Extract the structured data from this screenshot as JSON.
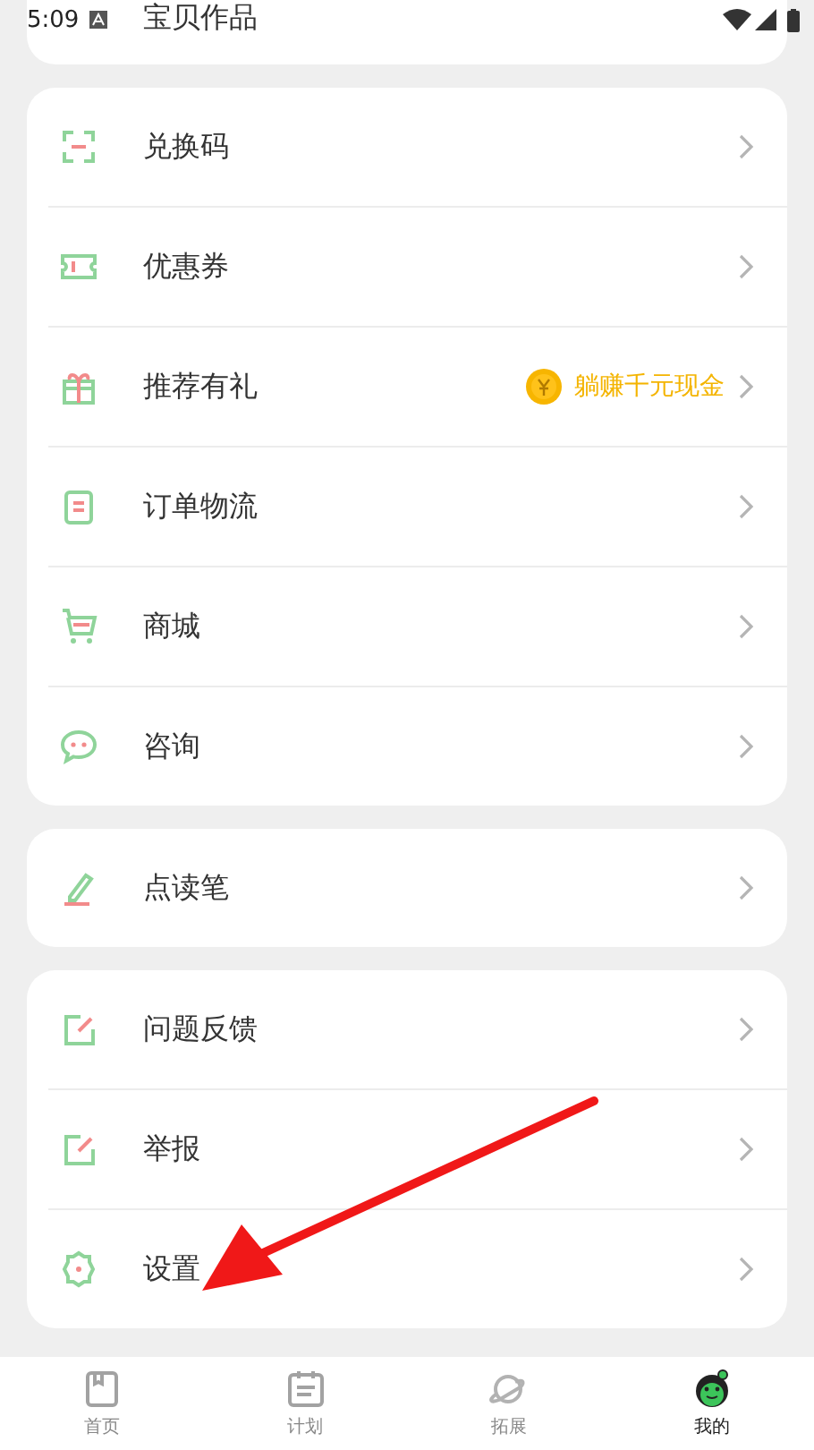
{
  "status_bar": {
    "time": "5:09"
  },
  "top_card": {
    "label": "宝贝作品"
  },
  "sections": [
    {
      "items": [
        {
          "label": "兑换码"
        },
        {
          "label": "优惠券"
        },
        {
          "label": "推荐有礼",
          "promo": "躺赚千元现金"
        },
        {
          "label": "订单物流"
        },
        {
          "label": "商城"
        },
        {
          "label": "咨询"
        }
      ]
    },
    {
      "items": [
        {
          "label": "点读笔"
        }
      ]
    },
    {
      "items": [
        {
          "label": "问题反馈"
        },
        {
          "label": "举报"
        },
        {
          "label": "设置"
        }
      ]
    }
  ],
  "tab_bar": [
    {
      "label": "首页",
      "selected": false
    },
    {
      "label": "计划",
      "selected": false
    },
    {
      "label": "拓展",
      "selected": false
    },
    {
      "label": "我的",
      "selected": true
    }
  ]
}
